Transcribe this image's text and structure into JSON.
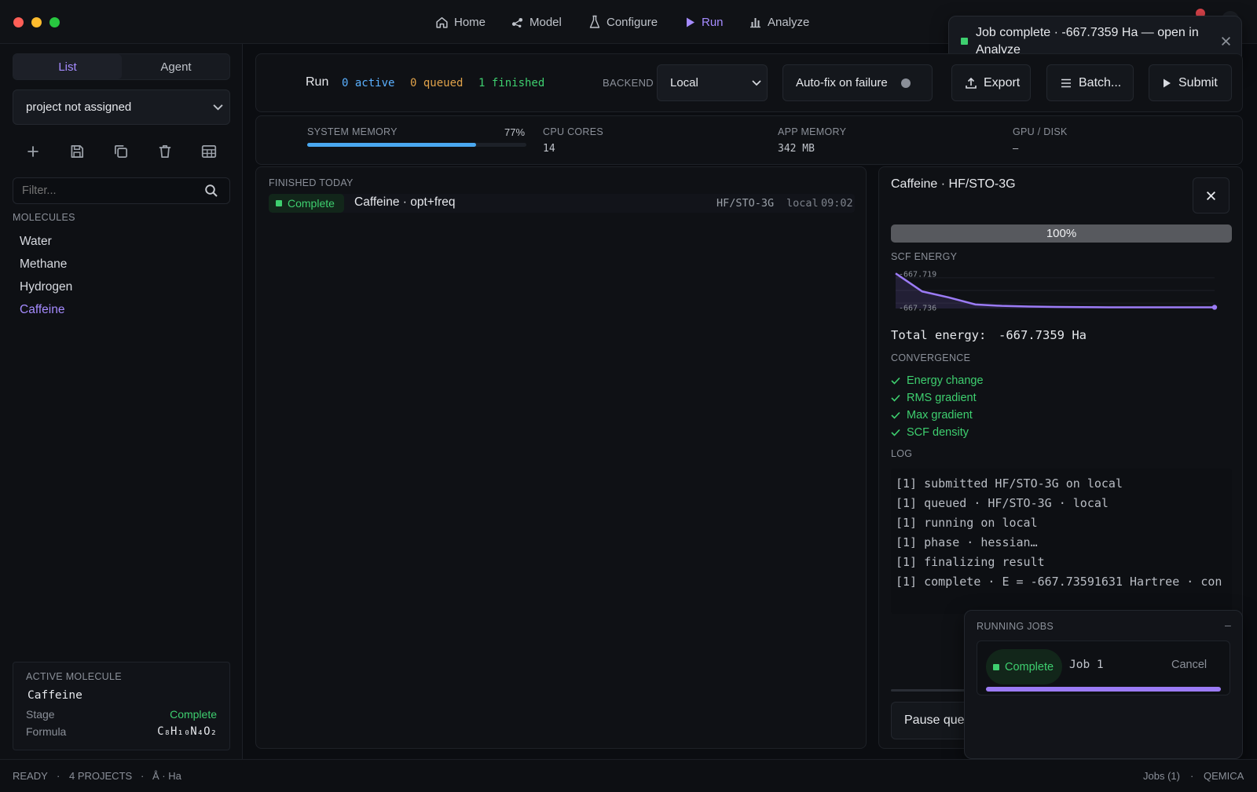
{
  "window": {
    "controls": [
      "close",
      "minimize",
      "maximize"
    ]
  },
  "nav": {
    "items": [
      "Home",
      "Model",
      "Configure",
      "Run",
      "Analyze"
    ],
    "active": "Run"
  },
  "toast": {
    "text": "Job complete · -667.7359 Ha — open in Analyze"
  },
  "sidebar": {
    "tabs": [
      "List",
      "Agent"
    ],
    "project_select": "project not assigned",
    "filter_placeholder": "Filter...",
    "molecules_label": "MOLECULES",
    "molecules": [
      "Water",
      "Methane",
      "Hydrogen",
      "Caffeine"
    ],
    "selected_molecule": "Caffeine",
    "active_card": {
      "title": "ACTIVE MOLECULE",
      "name": "Caffeine",
      "stage_label": "Stage",
      "stage_value": "Complete",
      "formula_label": "Formula",
      "formula_value": "C₈H₁₀N₄O₂"
    }
  },
  "run_header": {
    "title": "Run",
    "active": "0 active",
    "queued": "0 queued",
    "finished": "1 finished",
    "backend_label": "BACKEND",
    "backend_value": "Local",
    "autofix_label": "Auto-fix on failure",
    "export_label": "Export",
    "batch_label": "Batch...",
    "submit_label": "Submit"
  },
  "stats": {
    "system_memory_label": "SYSTEM MEMORY",
    "system_memory_value": "77%",
    "system_memory_fraction": 0.77,
    "cpu_label": "CPU CORES",
    "cpu_value": "14",
    "app_memory_label": "APP MEMORY",
    "app_memory_value": "342 MB",
    "gpu_label": "GPU / DISK",
    "gpu_value": "–"
  },
  "jobs": {
    "section_label": "FINISHED TODAY",
    "rows": [
      {
        "status": "Complete",
        "name": "Caffeine · opt+freq",
        "method": "HF/STO-3G",
        "backend": "local",
        "time": "09:02"
      }
    ]
  },
  "detail": {
    "title": "Caffeine · HF/STO-3G",
    "progress_label": "100%",
    "progress_fraction": 1.0,
    "scf_label": "SCF ENERGY",
    "scf_tick_top": "-667.719",
    "scf_tick_bottom": "-667.736",
    "total_energy_label": "Total energy:",
    "total_energy_value": "-667.7359 Ha",
    "convergence_label": "CONVERGENCE",
    "convergence": [
      "Energy change",
      "RMS gradient",
      "Max gradient",
      "SCF density"
    ],
    "log_label": "LOG",
    "log": [
      "[1] submitted HF/STO-3G on local",
      "[1] queued · HF/STO-3G · local",
      "[1] running on local",
      "[1] phase · hessian…",
      "[1] finalizing result",
      "[1] complete · E = -667.73591631 Hartree · con"
    ],
    "pause_label": "Pause que"
  },
  "running_jobs": {
    "title": "RUNNING JOBS",
    "collapse": "–",
    "status": "Complete",
    "job_name": "Job 1",
    "cancel_label": "Cancel",
    "progress_fraction": 1.0
  },
  "statusbar": {
    "ready": "READY",
    "projects": "4 PROJECTS",
    "units": "Å · Ha",
    "jobs": "Jobs (1)",
    "app": "QEMICA"
  },
  "colors": {
    "accent": "#a58bff",
    "success": "#3ecf6f",
    "info": "#5ab0ff",
    "warning": "#e0a24a",
    "memory_bar": "#4aa8f0",
    "job_progress": "#9b7bf5"
  },
  "chart_data": {
    "type": "line",
    "title": "SCF ENERGY",
    "ytick_labels": [
      "-667.719",
      "-667.736"
    ],
    "series": [
      {
        "values": [
          -667.719,
          -667.728,
          -667.731,
          -667.7345,
          -667.7352,
          -667.7355,
          -667.7357,
          -667.7358,
          -667.7359,
          -667.7359,
          -667.7359,
          -667.7359,
          -667.7359
        ]
      }
    ],
    "ylim": [
      -667.7365,
      -667.7185
    ],
    "grid": true
  }
}
